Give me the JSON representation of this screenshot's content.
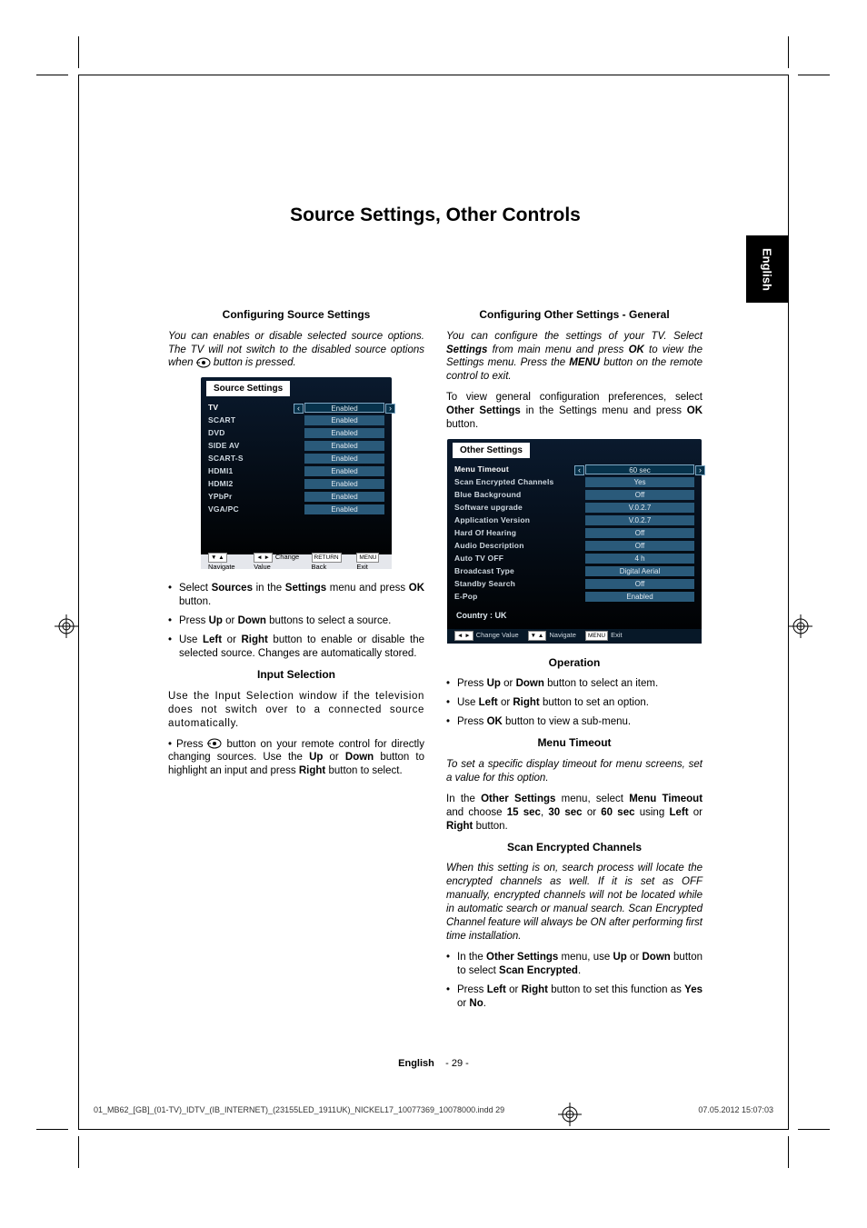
{
  "page": {
    "title": "Source Settings, Other Controls",
    "side_tab": "English",
    "footer_lang": "English",
    "footer_page": "- 29 -",
    "footer_file": "01_MB62_[GB]_(01-TV)_IDTV_(IB_INTERNET)_(23155LED_1911UK)_NICKEL17_10077369_10078000.indd   29",
    "footer_date": "07.05.2012   15:07:03"
  },
  "left": {
    "h1": "Configuring Source Settings",
    "intro": "You can enables or disable selected source options. The TV will not switch to the disabled source options when ",
    "intro_tail": " button is pressed.",
    "osd_title": "Source Settings",
    "sources": [
      {
        "label": "TV",
        "value": "Enabled",
        "selected": true
      },
      {
        "label": "SCART",
        "value": "Enabled"
      },
      {
        "label": "DVD",
        "value": "Enabled"
      },
      {
        "label": "SIDE AV",
        "value": "Enabled"
      },
      {
        "label": "SCART-S",
        "value": "Enabled"
      },
      {
        "label": "HDMI1",
        "value": "Enabled"
      },
      {
        "label": "HDMI2",
        "value": "Enabled"
      },
      {
        "label": "YPbPr",
        "value": "Enabled"
      },
      {
        "label": "VGA/PC",
        "value": "Enabled"
      }
    ],
    "footer_hints": {
      "nav_box": "▼ ▲",
      "nav": "Navigate",
      "cv_box": "◄ ►",
      "cv": "Change Value",
      "back_box": "RETURN",
      "back": "Back",
      "menu_box": "MENU",
      "menu": "Exit"
    },
    "bullets": [
      {
        "pre": "Select ",
        "b1": "Sources",
        "mid": " in the ",
        "b2": "Settings",
        "post": " menu and press ",
        "b3": "OK",
        "tail": " button."
      },
      {
        "pre": "Press ",
        "b1": "Up",
        "mid": " or ",
        "b2": "Down",
        "post": " buttons to select a source.",
        "tail": ""
      },
      {
        "pre": "Use ",
        "b1": "Left",
        "mid": " or ",
        "b2": "Right",
        "post": " button to enable or disable the selected source. Changes are automatically stored.",
        "tail": ""
      }
    ],
    "h2": "Input Selection",
    "p2": "Use the Input Selection window if the television does not switch over to a connected source automatically.",
    "p3_pre": "• Press ",
    "p3_mid": " button on your remote control for directly changing sources. Use the ",
    "p3_b1": "Up",
    "p3_or": " or ",
    "p3_b2": "Down",
    "p3_mid2": " button to highlight an input and press ",
    "p3_b3": "Right",
    "p3_tail": " button to select."
  },
  "right": {
    "h1": "Configuring Other Settings - General",
    "p1_a": "You can configure the settings of your TV. Select ",
    "p1_b": "Settings",
    "p1_c": " from main menu and press ",
    "p1_d": "OK",
    "p1_e": " to view the Settings menu. Press the ",
    "p1_f": "MENU",
    "p1_g": " button on the remote control to exit.",
    "p2_a": "To view general configuration preferences, select ",
    "p2_b": "Other Settings",
    "p2_c": " in the Settings menu and press ",
    "p2_d": "OK",
    "p2_e": " button.",
    "osd_title": "Other Settings",
    "settings": [
      {
        "label": "Menu Timeout",
        "value": "60 sec",
        "selected": true
      },
      {
        "label": "Scan Encrypted Channels",
        "value": "Yes"
      },
      {
        "label": "Blue Background",
        "value": "Off"
      },
      {
        "label": "Software upgrade",
        "value": "V.0.2.7"
      },
      {
        "label": "Application Version",
        "value": "V.0.2.7"
      },
      {
        "label": "Hard Of Hearing",
        "value": "Off"
      },
      {
        "label": "Audio Description",
        "value": "Off"
      },
      {
        "label": "Auto TV OFF",
        "value": "4 h"
      },
      {
        "label": "Broadcast Type",
        "value": "Digital Aerial"
      },
      {
        "label": "Standby Search",
        "value": "Off"
      },
      {
        "label": "E-Pop",
        "value": "Enabled"
      }
    ],
    "country": "Country : UK",
    "footer_hints": {
      "cv_box": "◄ ►",
      "cv": "Change Value",
      "nav_box": "▼ ▲",
      "nav": "Navigate",
      "menu_box": "MENU",
      "menu": "Exit"
    },
    "h2": "Operation",
    "op_bullets": [
      {
        "pre": "Press ",
        "b1": "Up",
        "mid": " or ",
        "b2": "Down",
        "post": " button to select an item."
      },
      {
        "pre": "Use ",
        "b1": "Left",
        "mid": " or ",
        "b2": "Right",
        "post": " button to set an option."
      },
      {
        "pre": "Press ",
        "b1": "OK",
        "mid": "",
        "b2": "",
        "post": " button to view a sub-menu."
      }
    ],
    "h3": "Menu Timeout",
    "mt_p1": "To set a specific display timeout for menu screens, set a value for this option.",
    "mt_p2_a": "In the ",
    "mt_p2_b": "Other Settings",
    "mt_p2_c": " menu, select ",
    "mt_p2_d": "Menu Timeout",
    "mt_p2_e": " and choose ",
    "mt_p2_f": "15 sec",
    "mt_p2_g": ", ",
    "mt_p2_h": "30 sec",
    "mt_p2_i": " or ",
    "mt_p2_j": "60 sec",
    "mt_p2_k": " using ",
    "mt_p2_l": "Left",
    "mt_p2_m": " or ",
    "mt_p2_n": "Right",
    "mt_p2_o": " button.",
    "h4": "Scan Encrypted Channels",
    "sec_p1": "When this setting is on, search process will locate the encrypted channels as well. If it is set as OFF manually, encrypted channels will not be located while in automatic search or manual search. Scan Encrypted Channel feature will always be ON after performing first time installation.",
    "sec_b1_a": "In the ",
    "sec_b1_b": "Other Settings",
    "sec_b1_c": " menu, use ",
    "sec_b1_d": "Up",
    "sec_b1_e": " or ",
    "sec_b1_f": "Down",
    "sec_b1_g": " button to select ",
    "sec_b1_h": "Scan Encrypted",
    "sec_b1_i": ".",
    "sec_b2_a": "Press ",
    "sec_b2_b": "Left",
    "sec_b2_c": " or ",
    "sec_b2_d": "Right",
    "sec_b2_e": " button to set this function as ",
    "sec_b2_f": "Yes",
    "sec_b2_g": " or ",
    "sec_b2_h": "No",
    "sec_b2_i": "."
  }
}
